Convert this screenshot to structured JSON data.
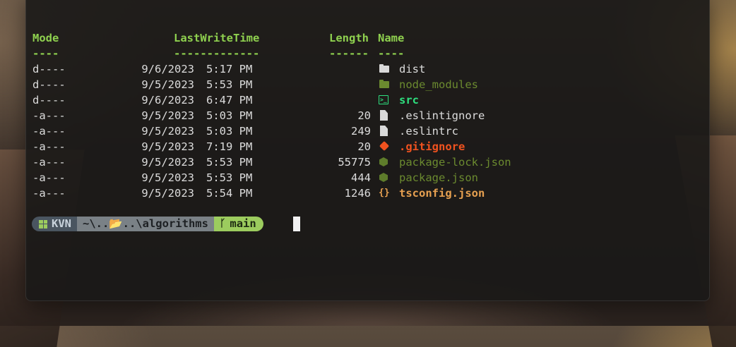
{
  "headers": {
    "mode": "Mode",
    "mode_ul": "----",
    "time": "LastWriteTime",
    "time_ul": "-------------",
    "length": "Length",
    "length_ul": "------",
    "name": "Name",
    "name_ul": "----"
  },
  "rows": [
    {
      "mode": "d----",
      "date": "9/6/2023",
      "time": "5:17 PM",
      "length": "",
      "name": "dist",
      "icon": "folder-icon",
      "color": "#dcdcdc"
    },
    {
      "mode": "d----",
      "date": "9/5/2023",
      "time": "5:53 PM",
      "length": "",
      "name": "node_modules",
      "icon": "folder-icon",
      "color": "#6b8a2f"
    },
    {
      "mode": "d----",
      "date": "9/6/2023",
      "time": "6:47 PM",
      "length": "",
      "name": "src",
      "icon": "terminal-folder-icon",
      "color": "#2ee07f"
    },
    {
      "mode": "-a---",
      "date": "9/5/2023",
      "time": "5:03 PM",
      "length": "20",
      "name": ".eslintignore",
      "icon": "file-icon",
      "color": "#dcdcdc"
    },
    {
      "mode": "-a---",
      "date": "9/5/2023",
      "time": "5:03 PM",
      "length": "249",
      "name": ".eslintrc",
      "icon": "file-icon",
      "color": "#dcdcdc"
    },
    {
      "mode": "-a---",
      "date": "9/5/2023",
      "time": "7:19 PM",
      "length": "20",
      "name": ".gitignore",
      "icon": "git-icon",
      "color": "#f0521f"
    },
    {
      "mode": "-a---",
      "date": "9/5/2023",
      "time": "5:53 PM",
      "length": "55775",
      "name": "package-lock.json",
      "icon": "node-icon",
      "color": "#6b8a2f"
    },
    {
      "mode": "-a---",
      "date": "9/5/2023",
      "time": "5:53 PM",
      "length": "444",
      "name": "package.json",
      "icon": "node-icon",
      "color": "#6b8a2f"
    },
    {
      "mode": "-a---",
      "date": "9/5/2023",
      "time": "5:54 PM",
      "length": "1246",
      "name": "tsconfig.json",
      "icon": "json-braces-icon",
      "color": "#e6a050"
    }
  ],
  "prompt": {
    "user": "KVN",
    "path": "~\\..📂..\\algorithms",
    "branch": "main"
  },
  "colors": {
    "header": "#8fd14f",
    "text": "#dcdcdc",
    "terminal_bg": "#1a1817"
  }
}
